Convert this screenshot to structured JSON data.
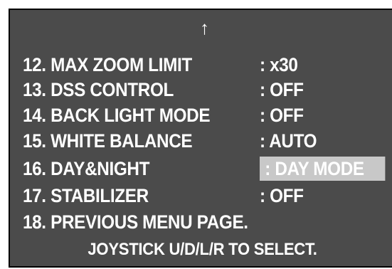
{
  "menu": {
    "scroll_up_glyph": "↑",
    "items": [
      {
        "label": "12. MAX ZOOM LIMIT",
        "value": ": x30"
      },
      {
        "label": "13. DSS CONTROL",
        "value": ": OFF"
      },
      {
        "label": "14. BACK LIGHT MODE",
        "value": ": OFF"
      },
      {
        "label": "15. WHITE BALANCE",
        "value": ": AUTO"
      },
      {
        "label": "16. DAY&NIGHT",
        "value": ": DAY MODE"
      },
      {
        "label": "17. STABILIZER",
        "value": ": OFF"
      },
      {
        "label": "18. PREVIOUS MENU PAGE.",
        "value": ""
      }
    ],
    "selected_index": 4,
    "footer": "JOYSTICK U/D/L/R TO SELECT."
  },
  "colors": {
    "screen_background": "#4b4b4b",
    "text": "#ffffff",
    "selection_highlight": "#c8c8c8"
  }
}
